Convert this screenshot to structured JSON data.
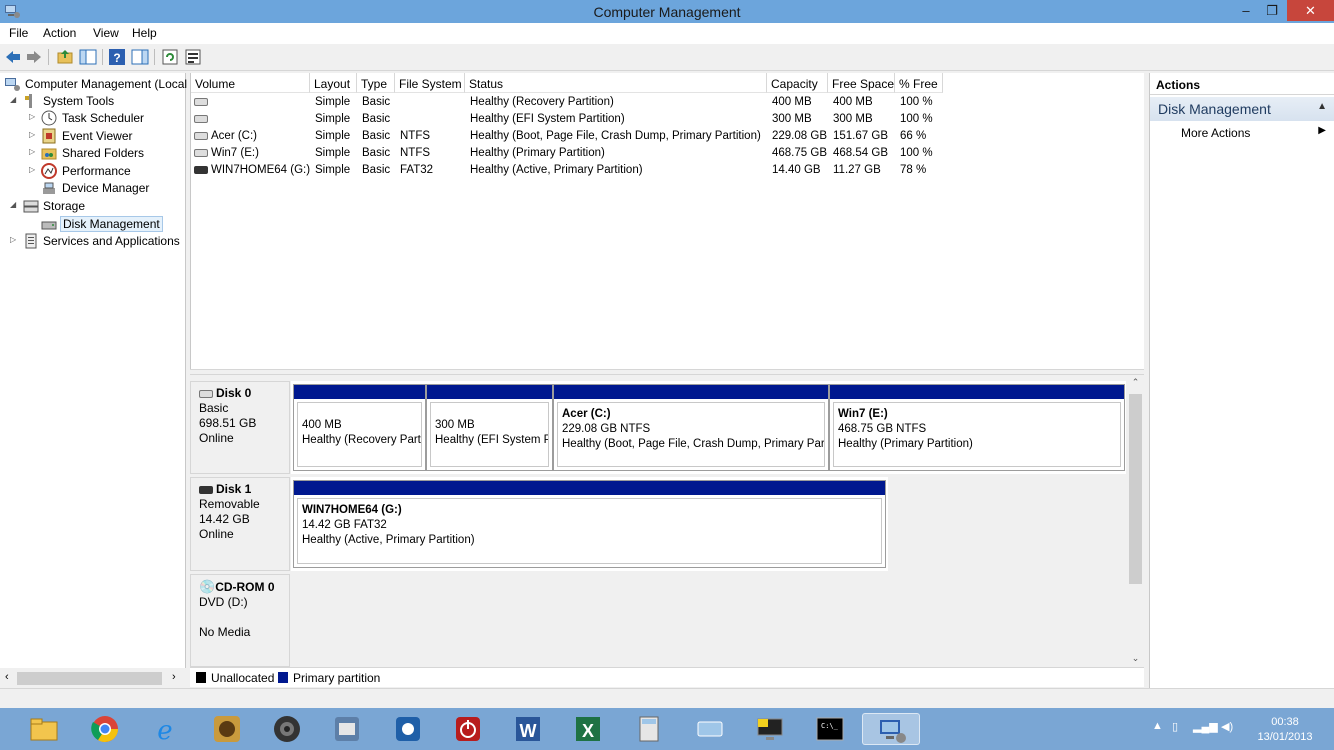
{
  "window": {
    "title": "Computer Management",
    "minimize_glyph": "–",
    "maximize_glyph": "❐",
    "close_glyph": "✕"
  },
  "menu": [
    "File",
    "Action",
    "View",
    "Help"
  ],
  "toolbar": [
    "back-arrow-icon",
    "forward-arrow-icon",
    "up-folder-icon",
    "show-hide-console-tree-icon",
    "help-icon",
    "show-hide-action-pane-icon",
    "refresh-icon",
    "properties-icon"
  ],
  "tree": {
    "root": "Computer Management (Local",
    "system_tools": "System Tools",
    "task_scheduler": "Task Scheduler",
    "event_viewer": "Event Viewer",
    "shared_folders": "Shared Folders",
    "performance": "Performance",
    "device_manager": "Device Manager",
    "storage": "Storage",
    "disk_management": "Disk Management",
    "services": "Services and Applications"
  },
  "volumes": {
    "headers": [
      "Volume",
      "Layout",
      "Type",
      "File System",
      "Status",
      "Capacity",
      "Free Space",
      "% Free"
    ],
    "rows": [
      {
        "volume": "",
        "layout": "Simple",
        "type": "Basic",
        "fs": "",
        "status": "Healthy (Recovery Partition)",
        "capacity": "400 MB",
        "free": "400 MB",
        "pct": "100 %"
      },
      {
        "volume": "",
        "layout": "Simple",
        "type": "Basic",
        "fs": "",
        "status": "Healthy (EFI System Partition)",
        "capacity": "300 MB",
        "free": "300 MB",
        "pct": "100 %"
      },
      {
        "volume": "Acer (C:)",
        "layout": "Simple",
        "type": "Basic",
        "fs": "NTFS",
        "status": "Healthy (Boot, Page File, Crash Dump, Primary Partition)",
        "capacity": "229.08 GB",
        "free": "151.67 GB",
        "pct": "66 %"
      },
      {
        "volume": "Win7 (E:)",
        "layout": "Simple",
        "type": "Basic",
        "fs": "NTFS",
        "status": "Healthy (Primary Partition)",
        "capacity": "468.75 GB",
        "free": "468.54 GB",
        "pct": "100 %"
      },
      {
        "volume": "WIN7HOME64 (G:)",
        "layout": "Simple",
        "type": "Basic",
        "fs": "FAT32",
        "status": "Healthy (Active, Primary Partition)",
        "capacity": "14.40 GB",
        "free": "11.27 GB",
        "pct": "78 %"
      }
    ]
  },
  "disks": {
    "disk0": {
      "name": "Disk 0",
      "type": "Basic",
      "size": "698.51 GB",
      "state": "Online",
      "parts": [
        {
          "name": "",
          "size": "400 MB",
          "status": "Healthy (Recovery Part"
        },
        {
          "name": "",
          "size": "300 MB",
          "status": "Healthy (EFI System P"
        },
        {
          "name": "Acer  (C:)",
          "size": "229.08 GB NTFS",
          "status": "Healthy (Boot, Page File, Crash Dump, Primary Part"
        },
        {
          "name": "Win7  (E:)",
          "size": "468.75 GB NTFS",
          "status": "Healthy (Primary Partition)"
        }
      ]
    },
    "disk1": {
      "name": "Disk 1",
      "type": "Removable",
      "size": "14.42 GB",
      "state": "Online",
      "parts": [
        {
          "name": "WIN7HOME64  (G:)",
          "size": "14.42 GB FAT32",
          "status": "Healthy (Active, Primary Partition)"
        }
      ]
    },
    "cdrom0": {
      "name": "CD-ROM 0",
      "type": "DVD (D:)",
      "state": "No Media"
    }
  },
  "legend": {
    "unallocated": "Unallocated",
    "primary": "Primary partition",
    "unallocated_color": "#000000",
    "primary_color": "#00188f"
  },
  "actions": {
    "header": "Actions",
    "section": "Disk Management",
    "item": "More Actions"
  },
  "taskbar": {
    "apps": [
      "file-explorer-icon",
      "chrome-icon",
      "internet-explorer-icon",
      "media-app-icon",
      "speaker-app-icon",
      "doc-app-icon",
      "settings-app-icon",
      "power-app-icon",
      "word-icon",
      "excel-icon",
      "calculator-icon",
      "app-icon",
      "monitor-app-icon",
      "command-prompt-icon",
      "computer-management-icon"
    ],
    "time": "00:38",
    "date": "13/01/2013"
  }
}
